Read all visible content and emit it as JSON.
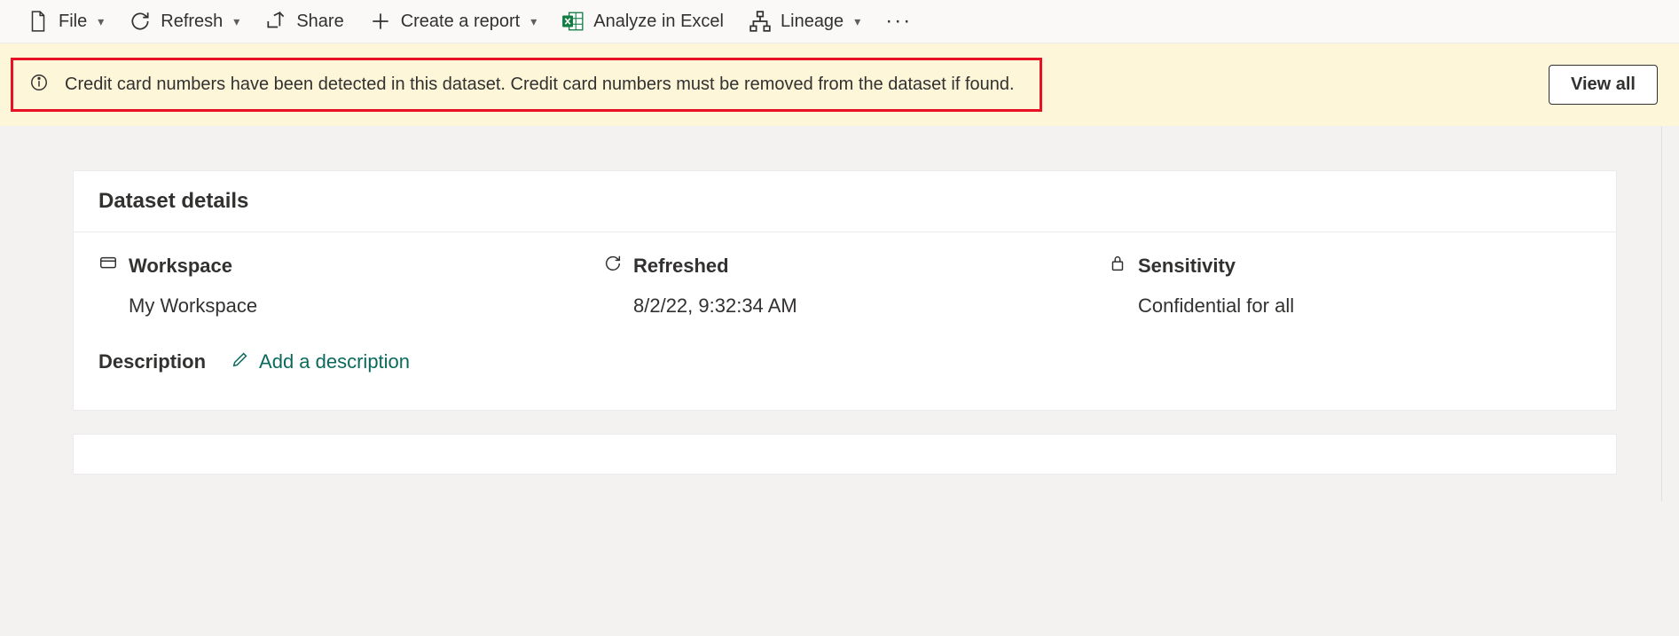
{
  "toolbar": {
    "file": "File",
    "refresh": "Refresh",
    "share": "Share",
    "create_report": "Create a report",
    "analyze_excel": "Analyze in Excel",
    "lineage": "Lineage"
  },
  "banner": {
    "message": "Credit card numbers have been detected in this dataset. Credit card numbers must be removed from the dataset if found.",
    "view_all": "View all"
  },
  "card": {
    "title": "Dataset details",
    "workspace": {
      "label": "Workspace",
      "value": "My Workspace"
    },
    "refreshed": {
      "label": "Refreshed",
      "value": "8/2/22, 9:32:34 AM"
    },
    "sensitivity": {
      "label": "Sensitivity",
      "value": "Confidential for all"
    },
    "description": {
      "label": "Description",
      "action": "Add a description"
    }
  }
}
